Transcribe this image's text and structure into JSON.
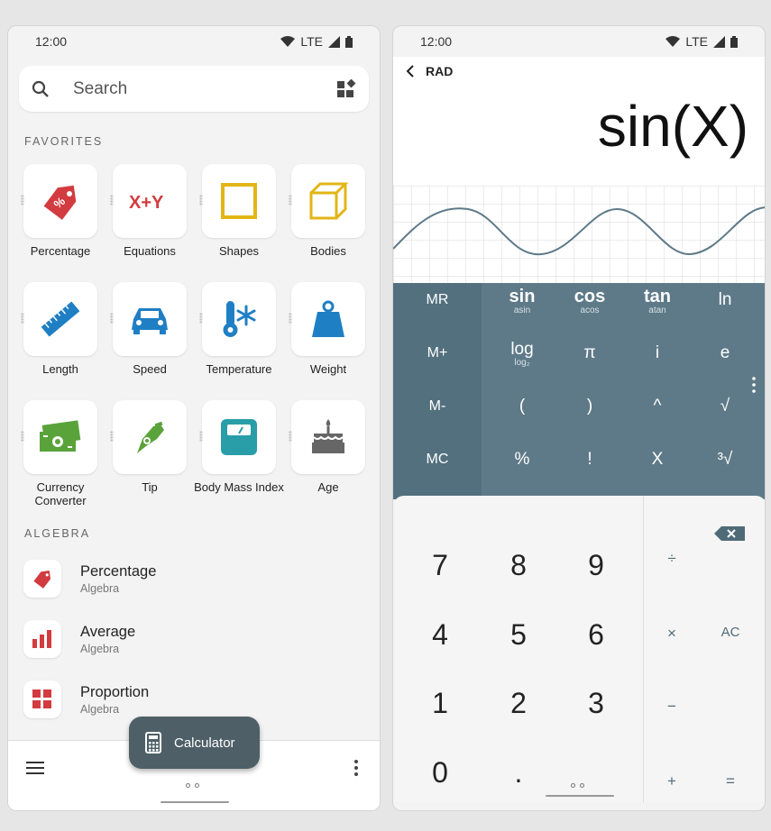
{
  "left": {
    "status": {
      "time": "12:00",
      "network": "LTE"
    },
    "search": {
      "placeholder": "Search"
    },
    "favorites_label": "FAVORITES",
    "favorites": [
      {
        "label": "Percentage",
        "icon": "percentage-tag-icon"
      },
      {
        "label": "Equations",
        "icon": "equations-xy-icon"
      },
      {
        "label": "Shapes",
        "icon": "square-shape-icon"
      },
      {
        "label": "Bodies",
        "icon": "cube-icon"
      },
      {
        "label": "Length",
        "icon": "ruler-icon"
      },
      {
        "label": "Speed",
        "icon": "car-icon"
      },
      {
        "label": "Temperature",
        "icon": "thermometer-icon"
      },
      {
        "label": "Weight",
        "icon": "weight-icon"
      },
      {
        "label": "Currency Converter",
        "icon": "banknote-icon"
      },
      {
        "label": "Tip",
        "icon": "hand-coin-icon"
      },
      {
        "label": "Body Mass Index",
        "icon": "scale-icon"
      },
      {
        "label": "Age",
        "icon": "cake-icon"
      }
    ],
    "algebra_label": "ALGEBRA",
    "algebra": [
      {
        "title": "Percentage",
        "subtitle": "Algebra",
        "icon": "percentage-tag-icon"
      },
      {
        "title": "Average",
        "subtitle": "Algebra",
        "icon": "bar-chart-icon"
      },
      {
        "title": "Proportion",
        "subtitle": "Algebra",
        "icon": "grid-icon"
      }
    ],
    "fab_label": "Calculator"
  },
  "right": {
    "status": {
      "time": "12:00",
      "network": "LTE"
    },
    "angle_mode": "RAD",
    "expression": "sin(X)",
    "memory_keys": [
      "MR",
      "M+",
      "M-",
      "MC"
    ],
    "sci_keys": [
      {
        "main": "sin",
        "sub": "asin"
      },
      {
        "main": "cos",
        "sub": "acos"
      },
      {
        "main": "tan",
        "sub": "atan"
      },
      {
        "main": "ln",
        "sub": ""
      },
      {
        "main": "log",
        "sub": "log₂"
      },
      {
        "main": "π",
        "sub": ""
      },
      {
        "main": "i",
        "sub": ""
      },
      {
        "main": "e",
        "sub": ""
      },
      {
        "main": "(",
        "sub": ""
      },
      {
        "main": ")",
        "sub": ""
      },
      {
        "main": "^",
        "sub": ""
      },
      {
        "main": "√",
        "sub": ""
      },
      {
        "main": "%",
        "sub": ""
      },
      {
        "main": "!",
        "sub": ""
      },
      {
        "main": "X",
        "sub": ""
      },
      {
        "main": "³√",
        "sub": ""
      }
    ],
    "digits": [
      "7",
      "8",
      "9",
      "4",
      "5",
      "6",
      "1",
      "2",
      "3",
      "0",
      "."
    ],
    "ops": [
      "÷",
      "×",
      "AC",
      "−",
      "+",
      "="
    ]
  },
  "colors": {
    "accent_red": "#d23b3f",
    "accent_yellow": "#e2b616",
    "accent_blue": "#1f7fc4",
    "accent_green": "#5aa33b",
    "accent_teal": "#2a9ea8",
    "sci_panel": "#5e7a88",
    "fab": "#4e5f67"
  }
}
